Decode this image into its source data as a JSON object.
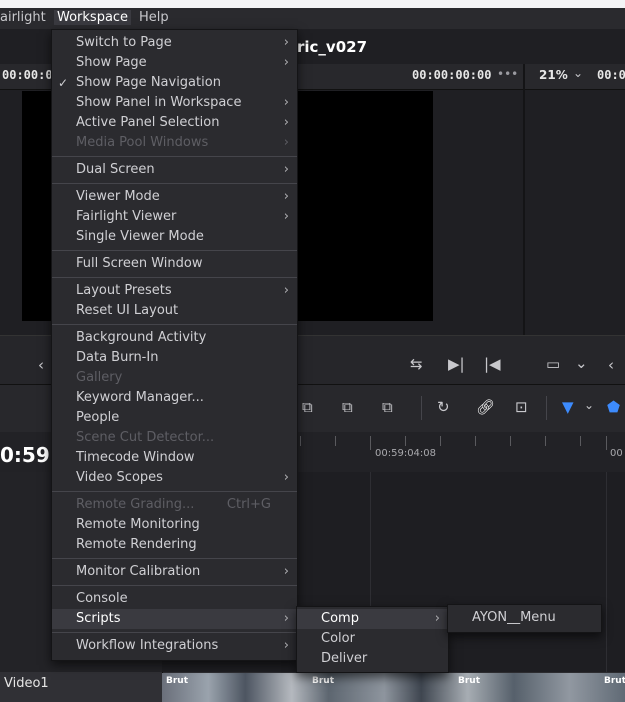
{
  "menubar": {
    "items": [
      "airlight",
      "Workspace",
      "Help"
    ]
  },
  "header": {
    "timeline_name": "ric_v027"
  },
  "viewer": {
    "tc_left": "00:00:00",
    "tc_source": "00:00:00:00",
    "dots": "•••",
    "zoom": "21%",
    "tc_right": "00:0"
  },
  "timeline": {
    "current_tc": "0:59:",
    "ruler_label_1": "00:59:04:08",
    "ruler_label_2": "00",
    "track_name": "Video1",
    "clip_label": "Brut"
  },
  "workspace_menu": {
    "items": [
      {
        "label": "Switch to Page",
        "submenu": true
      },
      {
        "label": "Show Page",
        "submenu": true
      },
      {
        "label": "Show Page Navigation",
        "checked": true
      },
      {
        "label": "Show Panel in Workspace",
        "submenu": true
      },
      {
        "label": "Active Panel Selection",
        "submenu": true
      },
      {
        "label": "Media Pool Windows",
        "submenu": true,
        "disabled": true
      },
      {
        "label": "Dual Screen",
        "submenu": true
      },
      {
        "label": "Viewer Mode",
        "submenu": true
      },
      {
        "label": "Fairlight Viewer",
        "submenu": true
      },
      {
        "label": "Single Viewer Mode"
      },
      {
        "label": "Full Screen Window"
      },
      {
        "label": "Layout Presets",
        "submenu": true
      },
      {
        "label": "Reset UI Layout"
      },
      {
        "label": "Background Activity"
      },
      {
        "label": "Data Burn-In"
      },
      {
        "label": "Gallery",
        "disabled": true
      },
      {
        "label": "Keyword Manager..."
      },
      {
        "label": "People"
      },
      {
        "label": "Scene Cut Detector...",
        "disabled": true
      },
      {
        "label": "Timecode Window"
      },
      {
        "label": "Video Scopes",
        "submenu": true
      },
      {
        "label": "Remote Grading...",
        "shortcut": "Ctrl+G",
        "disabled": true
      },
      {
        "label": "Remote Monitoring"
      },
      {
        "label": "Remote Rendering"
      },
      {
        "label": "Monitor Calibration",
        "submenu": true
      },
      {
        "label": "Console"
      },
      {
        "label": "Scripts",
        "submenu": true,
        "highlighted": true
      },
      {
        "label": "Workflow Integrations",
        "submenu": true
      }
    ]
  },
  "scripts_menu": {
    "items": [
      {
        "label": "Comp",
        "submenu": true,
        "highlighted": true
      },
      {
        "label": "Color"
      },
      {
        "label": "Deliver"
      }
    ]
  },
  "comp_menu": {
    "items": [
      {
        "label": "AYON__Menu"
      }
    ]
  },
  "colors": {
    "accent": "#3d8bfd",
    "menu_bg": "#2b2b2f",
    "highlight": "#3a3a40"
  }
}
